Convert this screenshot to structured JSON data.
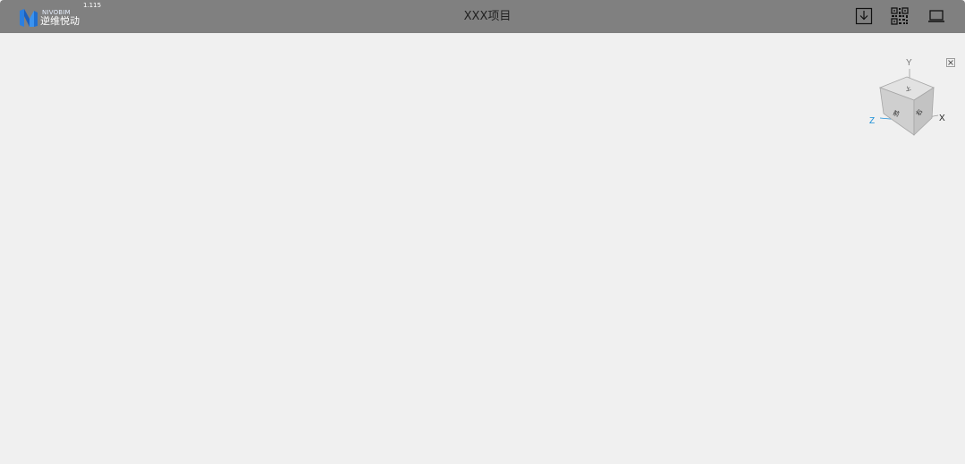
{
  "header": {
    "logo": {
      "brand_en": "NIVOBIM",
      "brand_cn": "逆维悦动"
    },
    "version": "1.115",
    "title": "XXX项目",
    "actions": [
      {
        "icon": "download-icon"
      },
      {
        "icon": "qr-code-icon"
      },
      {
        "icon": "laptop-icon"
      }
    ]
  },
  "view_cube": {
    "axis_x": "X",
    "axis_y": "Y",
    "axis_z": "Z",
    "close_icon": "close-icon"
  },
  "colors": {
    "header_bg": "#808080",
    "canvas_bg": "#f0f0f0",
    "logo_blue": "#1f6fd1",
    "axis_z": "#1a8fd8"
  }
}
